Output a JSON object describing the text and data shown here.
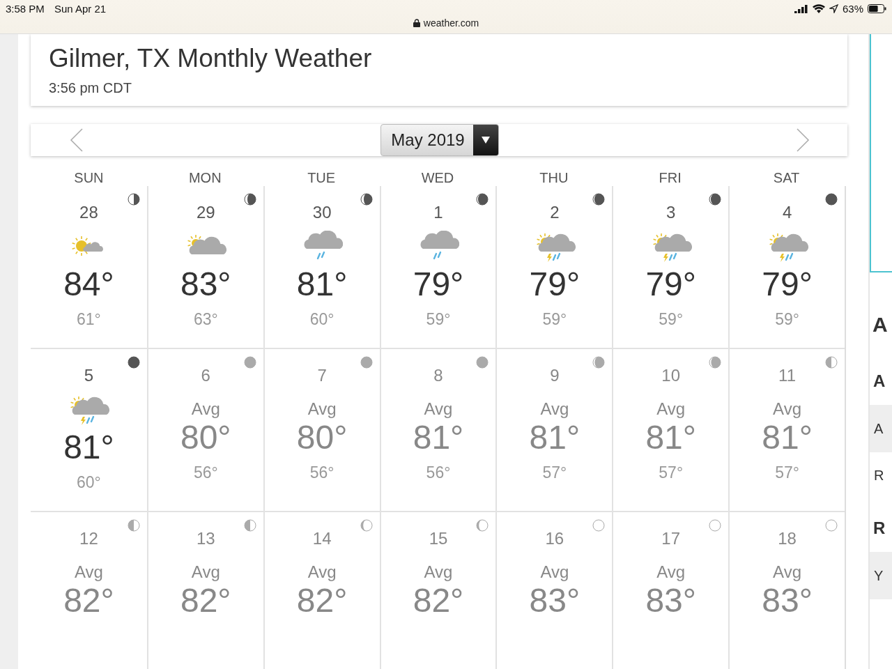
{
  "status_bar": {
    "time": "3:58 PM",
    "date": "Sun Apr 21",
    "battery": "63%",
    "url": "weather.com"
  },
  "header": {
    "title": "Gilmer, TX Monthly Weather",
    "time": "3:56 pm CDT"
  },
  "month_nav": {
    "month": "May 2019"
  },
  "weekdays": [
    "SUN",
    "MON",
    "TUE",
    "WED",
    "THU",
    "FRI",
    "SAT"
  ],
  "weeks": [
    [
      {
        "day": "28",
        "kind": "forecast",
        "weather": {
          "kind": "sun-cloud"
        },
        "moon": {
          "kind": "last-quarter"
        },
        "high": "84°",
        "low": "61°"
      },
      {
        "day": "29",
        "kind": "forecast",
        "weather": {
          "kind": "partly-cloudy"
        },
        "moon": {
          "kind": "waning-crescent"
        },
        "high": "83°",
        "low": "63°"
      },
      {
        "day": "30",
        "kind": "forecast",
        "weather": {
          "kind": "rain"
        },
        "moon": {
          "kind": "waning-crescent"
        },
        "high": "81°",
        "low": "60°"
      },
      {
        "day": "1",
        "kind": "forecast",
        "weather": {
          "kind": "rain"
        },
        "moon": {
          "kind": "waning-sliver"
        },
        "high": "79°",
        "low": "59°"
      },
      {
        "day": "2",
        "kind": "forecast",
        "weather": {
          "kind": "thunder"
        },
        "moon": {
          "kind": "waning-sliver"
        },
        "high": "79°",
        "low": "59°"
      },
      {
        "day": "3",
        "kind": "forecast",
        "weather": {
          "kind": "thunder"
        },
        "moon": {
          "kind": "waning-sliver"
        },
        "high": "79°",
        "low": "59°"
      },
      {
        "day": "4",
        "kind": "forecast",
        "weather": {
          "kind": "thunder"
        },
        "moon": {
          "kind": "new"
        },
        "high": "79°",
        "low": "59°"
      }
    ],
    [
      {
        "day": "5",
        "kind": "forecast",
        "weather": {
          "kind": "thunder"
        },
        "moon": {
          "kind": "new"
        },
        "high": "81°",
        "low": "60°"
      },
      {
        "day": "6",
        "kind": "average",
        "label": "Avg",
        "moon": {
          "kind": "new"
        },
        "high": "80°",
        "low": "56°"
      },
      {
        "day": "7",
        "kind": "average",
        "label": "Avg",
        "moon": {
          "kind": "new"
        },
        "high": "80°",
        "low": "56°"
      },
      {
        "day": "8",
        "kind": "average",
        "label": "Avg",
        "moon": {
          "kind": "new"
        },
        "high": "81°",
        "low": "56°"
      },
      {
        "day": "9",
        "kind": "average",
        "label": "Avg",
        "moon": {
          "kind": "waxing-sliver"
        },
        "high": "81°",
        "low": "57°"
      },
      {
        "day": "10",
        "kind": "average",
        "label": "Avg",
        "moon": {
          "kind": "waxing-sliver"
        },
        "high": "81°",
        "low": "57°"
      },
      {
        "day": "11",
        "kind": "average",
        "label": "Avg",
        "moon": {
          "kind": "first-quarter"
        },
        "high": "81°",
        "low": "57°"
      }
    ],
    [
      {
        "day": "12",
        "kind": "average",
        "label": "Avg",
        "moon": {
          "kind": "first-quarter"
        },
        "high": "82°"
      },
      {
        "day": "13",
        "kind": "average",
        "label": "Avg",
        "moon": {
          "kind": "first-quarter"
        },
        "high": "82°"
      },
      {
        "day": "14",
        "kind": "average",
        "label": "Avg",
        "moon": {
          "kind": "waxing-gibbous"
        },
        "high": "82°"
      },
      {
        "day": "15",
        "kind": "average",
        "label": "Avg",
        "moon": {
          "kind": "waxing-gibbous"
        },
        "high": "82°"
      },
      {
        "day": "16",
        "kind": "average",
        "label": "Avg",
        "moon": {
          "kind": "full"
        },
        "high": "83°"
      },
      {
        "day": "17",
        "kind": "average",
        "label": "Avg",
        "moon": {
          "kind": "full"
        },
        "high": "83°"
      },
      {
        "day": "18",
        "kind": "average",
        "label": "Avg",
        "moon": {
          "kind": "full"
        },
        "high": "83°"
      }
    ]
  ],
  "sidebar": {
    "heading": "A",
    "subheading_1": "A",
    "row_1": "A",
    "row_2": "R",
    "subheading_2": "R",
    "row_3": "Y"
  }
}
